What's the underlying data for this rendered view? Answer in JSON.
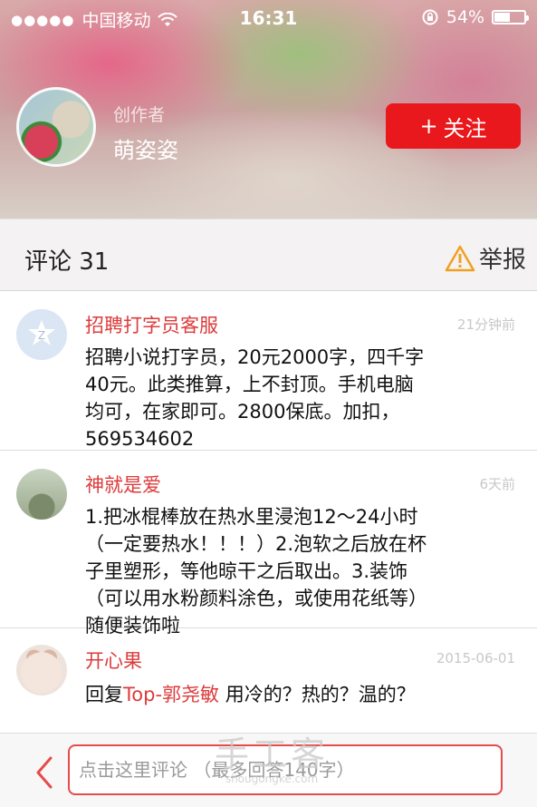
{
  "status_bar": {
    "carrier": "中国移动",
    "time": "16:31",
    "battery_text": "54%",
    "battery_level": 0.54
  },
  "profile": {
    "creator_label": "创作者",
    "creator_name": "萌姿姿",
    "follow_label": "关注",
    "follow_prefix": "+"
  },
  "comments_header": {
    "title": "评论 31",
    "report_label": "举报"
  },
  "comments": [
    {
      "name": "招聘打字员客服",
      "time": "21分钟前",
      "text": "招聘小说打字员，20元2000字，四千字40元。此类推算，上不封顶。手机电脑均可，在家即可。2800保底。加扣，569534602"
    },
    {
      "name": "神就是爱",
      "time": "6天前",
      "text": "1.把冰棍棒放在热水里浸泡12～24小时（一定要热水！！！）2.泡软之后放在杯子里塑形，等他晾干之后取出。3.装饰（可以用水粉颜料涂色，或使用花纸等）随便装饰啦"
    },
    {
      "name": "开心果",
      "time": "2015-06-01",
      "reply_prefix": "回复",
      "reply_to": "Top-郭尧敏",
      "text": " 用冷的？热的？温的？"
    }
  ],
  "input": {
    "placeholder": "点击这里评论 （最多回答140字）"
  },
  "watermark": {
    "title": "手工客",
    "url": "shougongke.com"
  },
  "colors": {
    "accent": "#e8181c",
    "name_red": "#dd3b3b",
    "report_orange": "#f0a020"
  }
}
